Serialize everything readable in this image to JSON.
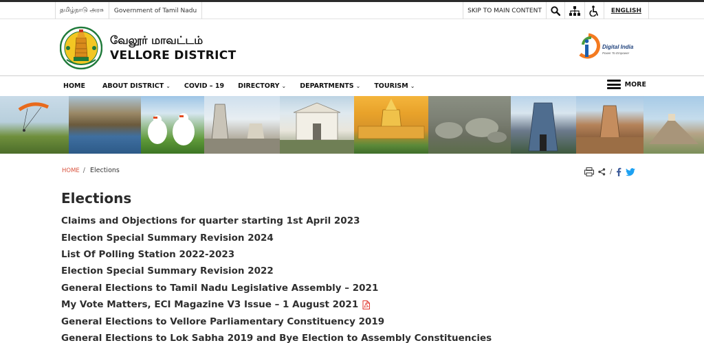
{
  "utility": {
    "tamil_gov": "தமிழ்நாடு அரசு",
    "english_gov": "Government of Tamil Nadu",
    "skip": "SKIP TO MAIN CONTENT",
    "language": "ENGLISH",
    "icons": [
      "search-icon",
      "sitemap-icon",
      "accessibility-icon"
    ]
  },
  "header": {
    "title_tamil": "வேலூர் மாவட்டம்",
    "title_english": "VELLORE DISTRICT",
    "partner_logo": "digital-india-logo"
  },
  "nav": {
    "items": [
      {
        "label": "HOME",
        "dropdown": false
      },
      {
        "label": "ABOUT DISTRICT",
        "dropdown": true
      },
      {
        "label": "COVID – 19",
        "dropdown": false
      },
      {
        "label": "DIRECTORY",
        "dropdown": true
      },
      {
        "label": "DEPARTMENTS",
        "dropdown": true
      },
      {
        "label": "TOURISM",
        "dropdown": true
      }
    ],
    "more": "MORE"
  },
  "breadcrumb": {
    "home": "HOME",
    "current": "Elections"
  },
  "page": {
    "title": "Elections",
    "links": [
      {
        "text": "Claims and Objections for quarter starting 1st April 2023",
        "pdf": false
      },
      {
        "text": "Election Special Summary Revision 2024",
        "pdf": false
      },
      {
        "text": "List Of Polling Station 2022-2023",
        "pdf": false
      },
      {
        "text": "Election Special Summary Revision 2022",
        "pdf": false
      },
      {
        "text": "General Elections to Tamil Nadu Legislative Assembly – 2021",
        "pdf": false
      },
      {
        "text": "My Vote Matters, ECI Magazine V3 Issue – 1 August 2021",
        "pdf": true
      },
      {
        "text": "General Elections to Vellore Parliamentary Constituency 2019",
        "pdf": false
      },
      {
        "text": "General Elections to Lok Sabha 2019 and Bye Election to Assembly Constituencies",
        "pdf": false
      }
    ]
  },
  "colors": {
    "breadcrumb_home": "#d9533e",
    "twitter": "#1da1f2",
    "facebook": "#3b5998",
    "pdf": "#e0342b"
  }
}
